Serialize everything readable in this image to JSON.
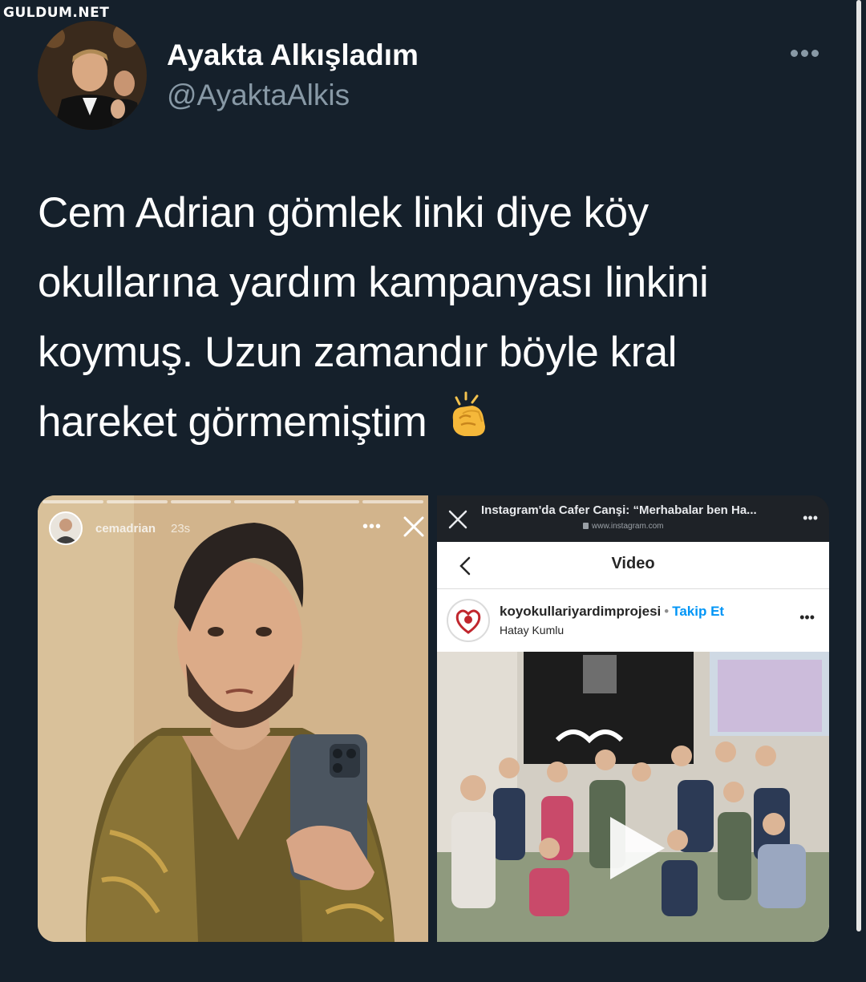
{
  "watermark": "GULDUM.NET",
  "tweet": {
    "display_name": "Ayakta Alkışladım",
    "handle": "@AyaktaAlkis",
    "text": "Cem Adrian gömlek linki diye köy okullarına yardım kampanyası linkini koymuş. Uzun zamandır böyle kral hareket görmemiştim",
    "emoji_icon": "clapping-hands-icon"
  },
  "story": {
    "username": "cemadrian",
    "time": "23s"
  },
  "browser": {
    "title": "Instagram'da Cafer Canşi: “Merhabalar ben Ha...",
    "url": "www.instagram.com"
  },
  "instagram": {
    "nav_title": "Video",
    "account": "koyokullariyardimprojesi",
    "follow_label": "Takip Et",
    "location": "Hatay Kumlu"
  },
  "colors": {
    "background": "#15202b",
    "muted": "#8899a6",
    "link": "#0095f6"
  }
}
